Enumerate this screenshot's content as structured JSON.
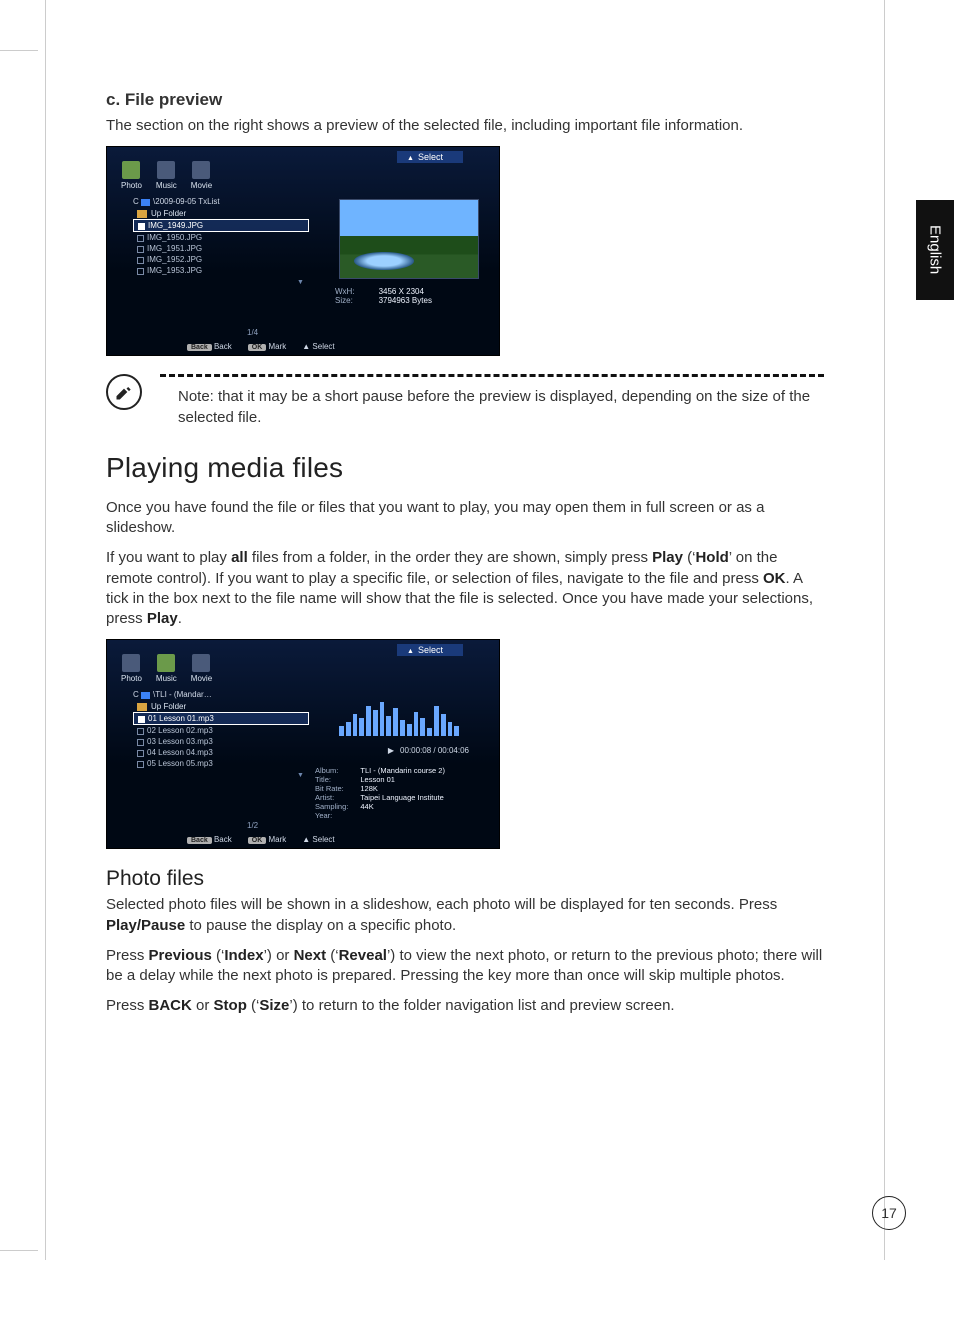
{
  "page": {
    "lang_tab": "English",
    "number": "17"
  },
  "section_c": {
    "title": "c.   File preview",
    "body": "The section on the right shows a preview of the selected file, including important file information."
  },
  "shot1": {
    "cats": [
      "Photo",
      "Music",
      "Movie"
    ],
    "topbar": "Select",
    "drive": "C",
    "crumb": "\\2009-09-05 TxList",
    "up": "Up Folder",
    "files": [
      "IMG_1949.JPG",
      "IMG_1950.JPG",
      "IMG_1951.JPG",
      "IMG_1952.JPG",
      "IMG_1953.JPG"
    ],
    "pager": "1/4",
    "info_labels": "WxH:\nSize:",
    "info_vals": "3456 X 2304\n3794963 Bytes",
    "bot": {
      "back_key": "Back",
      "back": "Back",
      "ok_key": "OK",
      "ok": "Mark",
      "sel": "Select"
    }
  },
  "note": "Note: that it may be a short pause before the preview is displayed, depending on the size of the selected file.",
  "playing": {
    "heading": "Playing media files",
    "p1": "Once you have found the file or files that you want to play, you may open them in full screen or as a slideshow.",
    "p2_a": "If you want to play ",
    "p2_b_all": "all",
    "p2_c": " files from a folder, in the order they are shown, simply press ",
    "p2_d_play": "Play",
    "p2_e": " (‘",
    "p2_f_hold": "Hold",
    "p2_g": "’ on the remote control).  If you want to play a specific file, or selection of files, navigate to the file and press ",
    "p2_h_ok": "OK",
    "p2_i": ". A tick in the box next to the file name will show that the file is selected. Once you have made your selections, press ",
    "p2_j_play": "Play",
    "p2_k": "."
  },
  "shot2": {
    "cats": [
      "Photo",
      "Music",
      "Movie"
    ],
    "topbar": "Select",
    "drive": "C",
    "crumb": "\\TLI -  (Mandar…",
    "up": "Up Folder",
    "files": [
      "01 Lesson 01.mp3",
      "02 Lesson 02.mp3",
      "03 Lesson 03.mp3",
      "04 Lesson 04.mp3",
      "05 Lesson 05.mp3"
    ],
    "pager": "1/2",
    "playpos": "00:00:08 / 00:04:06",
    "info_labels": "Album:\nTitle:\nBit Rate:\nArtist:\nSampling:\nYear:",
    "info_vals": "TLI -  (Mandarin course 2)\nLesson 01\n128K\nTaipei Language Institute\n44K\n",
    "bot": {
      "back_key": "Back",
      "back": "Back",
      "ok_key": "OK",
      "ok": "Mark",
      "sel": "Select"
    },
    "eq_heights": [
      10,
      14,
      22,
      18,
      30,
      26,
      34,
      20,
      28,
      16,
      12,
      24,
      18,
      8,
      30,
      22,
      14,
      10
    ]
  },
  "photo": {
    "heading": "Photo files",
    "p1_a": "Selected photo files will be shown in a slideshow, each photo will be displayed for ten seconds. Press ",
    "p1_b": "Play/Pause",
    "p1_c": " to pause the display on a specific photo.",
    "p2_a": "Press ",
    "p2_b": "Previous",
    "p2_c": " (‘",
    "p2_d": "Index",
    "p2_e": "’) or ",
    "p2_f": "Next",
    "p2_g": " (‘",
    "p2_h": "Reveal",
    "p2_i": "’) to view the next photo, or return to the previous photo; there will be a delay while the next photo is prepared. Pressing the key more than once will skip multiple photos.",
    "p3_a": "Press ",
    "p3_b": "BACK",
    "p3_c": " or ",
    "p3_d": "Stop",
    "p3_e": " (‘",
    "p3_f": "Size",
    "p3_g": "’) to return to the folder navigation list and preview screen."
  }
}
